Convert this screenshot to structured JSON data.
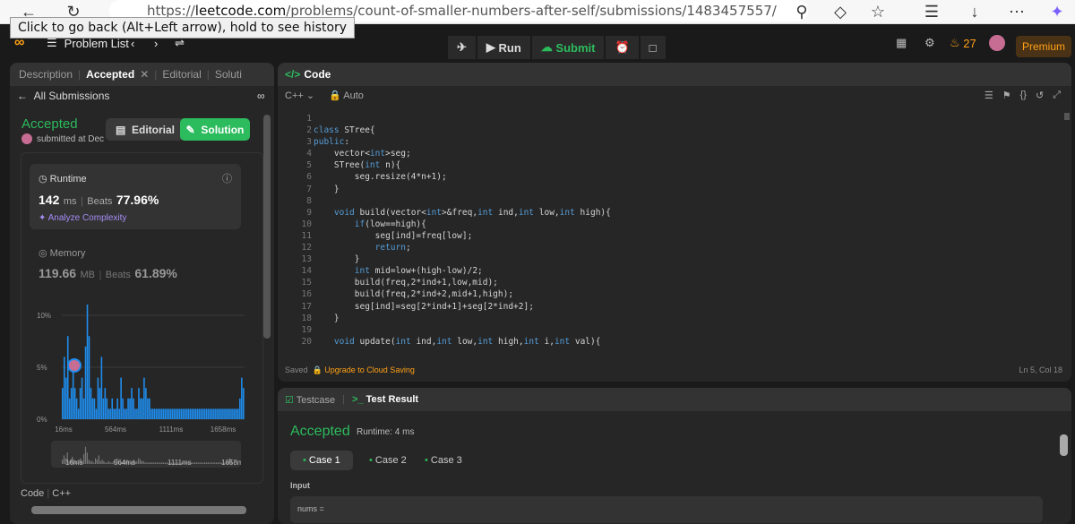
{
  "browser": {
    "url_prefix": "https://",
    "url_host": "leetcode.com",
    "url_path": "/problems/count-of-smaller-numbers-after-self/submissions/1483457557/",
    "tooltip": "Click to go back (Alt+Left arrow), hold to see history"
  },
  "navbar": {
    "problem_list": "Problem List",
    "run": "Run",
    "submit": "Submit",
    "streak": "27",
    "premium": "Premium"
  },
  "left": {
    "tabs": [
      "Description",
      "Accepted",
      "Editorial",
      "Soluti"
    ],
    "all_submissions": "All Submissions",
    "status": "Accepted",
    "submitted": "submitted at Dec",
    "editorial_btn": "Editorial",
    "solution_btn": "Solution",
    "runtime_label": "Runtime",
    "runtime_value": "142",
    "runtime_unit": "ms",
    "runtime_beats_label": "Beats",
    "runtime_beats": "77.96%",
    "analyze": "Analyze Complexity",
    "memory_label": "Memory",
    "memory_value": "119.66",
    "memory_unit": "MB",
    "memory_beats_label": "Beats",
    "memory_beats": "61.89%",
    "code_label": "Code",
    "code_lang": "C++"
  },
  "chart_data": {
    "type": "bar",
    "ytick_labels": [
      "10%",
      "5%",
      "0%"
    ],
    "xtick_labels": [
      "16ms",
      "564ms",
      "1111ms",
      "1658ms"
    ],
    "minimap_labels": [
      "16ms",
      "564ms",
      "1111ms",
      "1658ms"
    ],
    "values": [
      3,
      6,
      4,
      8,
      2,
      3,
      5,
      3,
      2,
      1,
      3,
      4,
      2,
      7,
      12,
      8,
      3,
      2,
      2,
      1,
      4,
      3,
      6,
      2,
      3,
      2,
      1,
      1,
      2,
      1,
      1,
      2,
      1,
      4,
      2,
      1,
      1,
      2,
      2,
      3,
      2,
      1,
      1,
      3,
      2,
      2,
      4,
      3,
      2,
      2,
      1,
      1,
      1,
      1,
      1,
      1,
      1,
      1,
      1,
      1,
      1,
      1,
      1,
      1,
      1,
      1,
      1,
      1,
      1,
      1,
      1,
      1,
      1,
      1,
      1,
      1,
      1,
      1,
      1,
      1,
      1,
      1,
      1,
      1,
      1,
      1,
      1,
      1,
      1,
      1,
      1,
      1,
      1,
      1,
      1,
      1,
      1,
      1,
      1,
      1,
      2,
      4,
      3
    ]
  },
  "code_panel": {
    "title": "Code",
    "lang": "C++",
    "mode": "Auto",
    "saved": "Saved",
    "upgrade": "Upgrade to Cloud Saving",
    "cursor": "Ln 5, Col 18",
    "line_numbers": [
      "1",
      "2",
      "3",
      "4",
      "5",
      "6",
      "7",
      "8",
      "9",
      "10",
      "11",
      "12",
      "13",
      "14",
      "15",
      "16",
      "17",
      "18",
      "19",
      "20"
    ]
  },
  "result": {
    "tab_testcase": "Testcase",
    "tab_result": "Test Result",
    "status": "Accepted",
    "runtime": "Runtime: 4 ms",
    "cases": [
      "Case 1",
      "Case 2",
      "Case 3"
    ],
    "input_label": "Input",
    "input_value": "nums ="
  }
}
